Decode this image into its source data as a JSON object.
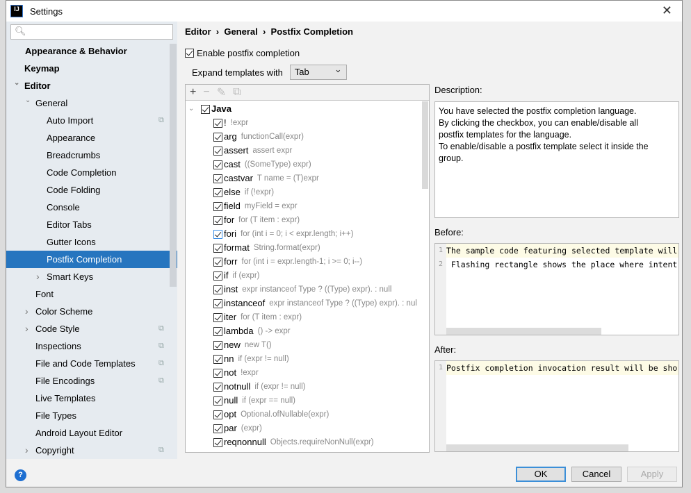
{
  "window": {
    "title": "Settings",
    "logo": "IJ"
  },
  "search": {
    "placeholder": ""
  },
  "sidebar": {
    "items": [
      {
        "label": "Appearance & Behavior",
        "level": 0,
        "bold": true,
        "arrow": ""
      },
      {
        "label": "Keymap",
        "level": 0,
        "bold": true,
        "arrow": ""
      },
      {
        "label": "Editor",
        "level": 0,
        "bold": true,
        "arrow": "down"
      },
      {
        "label": "General",
        "level": 1,
        "arrow": "down"
      },
      {
        "label": "Auto Import",
        "level": 2,
        "copy": true
      },
      {
        "label": "Appearance",
        "level": 2
      },
      {
        "label": "Breadcrumbs",
        "level": 2
      },
      {
        "label": "Code Completion",
        "level": 2
      },
      {
        "label": "Code Folding",
        "level": 2
      },
      {
        "label": "Console",
        "level": 2
      },
      {
        "label": "Editor Tabs",
        "level": 2
      },
      {
        "label": "Gutter Icons",
        "level": 2
      },
      {
        "label": "Postfix Completion",
        "level": 2,
        "selected": true
      },
      {
        "label": "Smart Keys",
        "level": 2,
        "arrow": "right"
      },
      {
        "label": "Font",
        "level": 1
      },
      {
        "label": "Color Scheme",
        "level": 1,
        "arrow": "right"
      },
      {
        "label": "Code Style",
        "level": 1,
        "arrow": "right",
        "copy": true
      },
      {
        "label": "Inspections",
        "level": 1,
        "copy": true
      },
      {
        "label": "File and Code Templates",
        "level": 1,
        "copy": true
      },
      {
        "label": "File Encodings",
        "level": 1,
        "copy": true
      },
      {
        "label": "Live Templates",
        "level": 1
      },
      {
        "label": "File Types",
        "level": 1
      },
      {
        "label": "Android Layout Editor",
        "level": 1
      },
      {
        "label": "Copyright",
        "level": 1,
        "arrow": "right",
        "copy": true
      }
    ]
  },
  "breadcrumb": [
    "Editor",
    "General",
    "Postfix Completion"
  ],
  "enable_label": "Enable postfix completion",
  "expand_label": "Expand templates with",
  "expand_value": "Tab",
  "toolbar_icons": [
    "plus-icon",
    "minus-icon",
    "edit-icon",
    "copy-icon"
  ],
  "tree_root": "Java",
  "templates": [
    {
      "key": "!",
      "desc": "!expr"
    },
    {
      "key": "arg",
      "desc": "functionCall(expr)"
    },
    {
      "key": "assert",
      "desc": "assert expr"
    },
    {
      "key": "cast",
      "desc": "((SomeType) expr)"
    },
    {
      "key": "castvar",
      "desc": "T name = (T)expr"
    },
    {
      "key": "else",
      "desc": "if (!expr)"
    },
    {
      "key": "field",
      "desc": "myField = expr"
    },
    {
      "key": "for",
      "desc": "for (T item : expr)"
    },
    {
      "key": "fori",
      "desc": "for (int i = 0; i < expr.length; i++)",
      "focused": true
    },
    {
      "key": "format",
      "desc": "String.format(expr)"
    },
    {
      "key": "forr",
      "desc": "for (int i = expr.length-1; i >= 0; i--)"
    },
    {
      "key": "if",
      "desc": "if (expr)"
    },
    {
      "key": "inst",
      "desc": "expr instanceof Type ? ((Type) expr). : null"
    },
    {
      "key": "instanceof",
      "desc": "expr instanceof Type ? ((Type) expr). : nul"
    },
    {
      "key": "iter",
      "desc": "for (T item : expr)"
    },
    {
      "key": "lambda",
      "desc": "() -> expr"
    },
    {
      "key": "new",
      "desc": "new T()"
    },
    {
      "key": "nn",
      "desc": "if (expr != null)"
    },
    {
      "key": "not",
      "desc": "!expr"
    },
    {
      "key": "notnull",
      "desc": "if (expr != null)"
    },
    {
      "key": "null",
      "desc": "if (expr == null)"
    },
    {
      "key": "opt",
      "desc": "Optional.ofNullable(expr)"
    },
    {
      "key": "par",
      "desc": "(expr)"
    },
    {
      "key": "reqnonnull",
      "desc": "Objects.requireNonNull(expr)"
    }
  ],
  "description": {
    "label": "Description:",
    "lines": [
      "You have selected the postfix completion language.",
      "By clicking the checkbox, you can enable/disable all",
      "postfix templates for the language.",
      "To enable/disable a postfix template select it inside the",
      "group."
    ]
  },
  "before": {
    "label": "Before:",
    "lines": [
      "The sample code featuring selected template will",
      " Flashing rectangle shows the place where intent"
    ]
  },
  "after": {
    "label": "After:",
    "lines": [
      "Postfix completion invocation result will be sho"
    ]
  },
  "buttons": {
    "ok": "OK",
    "cancel": "Cancel",
    "apply": "Apply",
    "help": "?"
  },
  "colors": {
    "selection": "#2675bf",
    "sidebar_bg": "#e6ebf0"
  }
}
